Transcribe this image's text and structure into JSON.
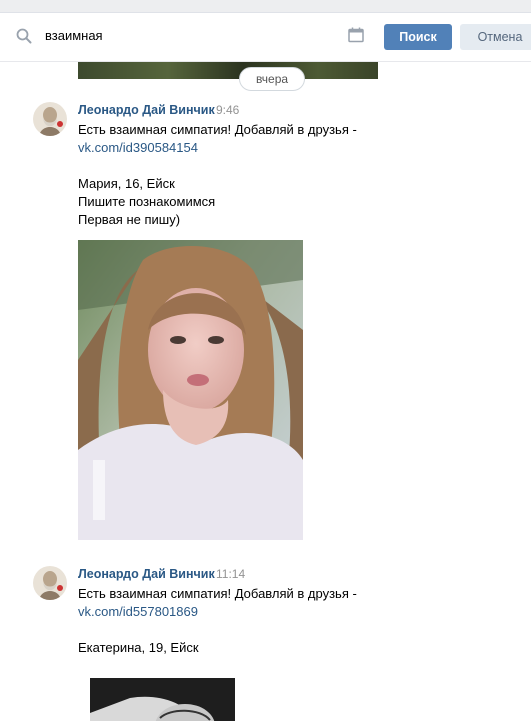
{
  "search": {
    "query": "взаимная",
    "search_button": "Поиск",
    "cancel_button": "Отмена"
  },
  "feed": {
    "date_separator": "вчера",
    "messages": [
      {
        "author": "Леонардо Дай Винчик",
        "time": "9:46",
        "lines": [
          "Есть взаимная симпатия! Добавляй в друзья -",
          "vk.com/id390584154",
          "Мария, 16, Ейск",
          "Пишите познакомимся",
          "Первая не пишу)"
        ]
      },
      {
        "author": "Леонардо Дай Винчик",
        "time": "11:14",
        "lines": [
          "Есть взаимная симпатия! Добавляй в друзья -",
          "vk.com/id557801869",
          "Екатерина, 19, Ейск"
        ]
      }
    ]
  },
  "colors": {
    "accent": "#5181b8",
    "link": "#2a5885",
    "muted": "#939393"
  }
}
